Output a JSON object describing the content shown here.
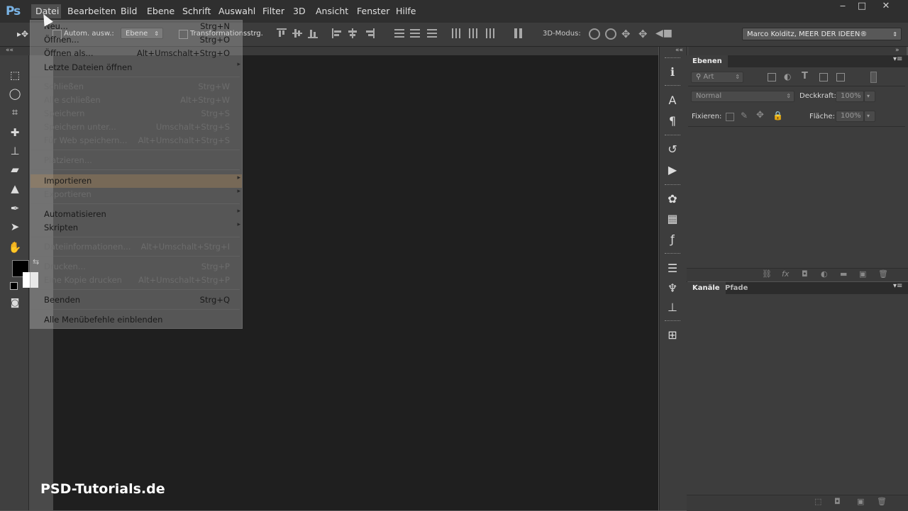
{
  "app": {
    "logo": "Ps"
  },
  "menubar": {
    "items": [
      "Datei",
      "Bearbeiten",
      "Bild",
      "Ebene",
      "Schrift",
      "Auswahl",
      "Filter",
      "3D",
      "Ansicht",
      "Fenster",
      "Hilfe"
    ],
    "window_buttons": {
      "minimize": "‒",
      "maximize": "□",
      "close": "✕"
    }
  },
  "options_bar": {
    "auto_select_label": "Autom. ausw.:",
    "auto_select_value": "Ebene",
    "transform_label": "Transformationsstrg.",
    "mode_3d_label": "3D-Modus:",
    "workspace": "Marco Kolditz, MEER DER IDEEN®"
  },
  "file_menu": {
    "items": [
      {
        "label": "Neu...",
        "shortcut": "Strg+N",
        "disabled": false
      },
      {
        "label": "Öffnen...",
        "shortcut": "Strg+O",
        "disabled": false
      },
      {
        "label": "Öffnen als...",
        "shortcut": "Alt+Umschalt+Strg+O",
        "disabled": false
      },
      {
        "label": "Letzte Dateien öffnen",
        "shortcut": "",
        "submenu": "▸",
        "disabled": false
      },
      {
        "label": "Schließen",
        "shortcut": "Strg+W",
        "disabled": true
      },
      {
        "label": "Alle schließen",
        "shortcut": "Alt+Strg+W",
        "disabled": true
      },
      {
        "label": "Speichern",
        "shortcut": "Strg+S",
        "disabled": true
      },
      {
        "label": "Speichern unter...",
        "shortcut": "Umschalt+Strg+S",
        "disabled": true
      },
      {
        "label": "Für Web speichern...",
        "shortcut": "Alt+Umschalt+Strg+S",
        "disabled": true
      },
      {
        "label": "Platzieren...",
        "shortcut": "",
        "disabled": true
      },
      {
        "label": "Importieren",
        "shortcut": "",
        "submenu": "▸",
        "disabled": false
      },
      {
        "label": "Exportieren",
        "shortcut": "",
        "submenu": "▸",
        "disabled": true
      },
      {
        "label": "Automatisieren",
        "shortcut": "",
        "submenu": "▸",
        "disabled": false
      },
      {
        "label": "Skripten",
        "shortcut": "",
        "submenu": "▸",
        "disabled": false
      },
      {
        "label": "Dateiinformationen...",
        "shortcut": "Alt+Umschalt+Strg+I",
        "disabled": true
      },
      {
        "label": "Drucken...",
        "shortcut": "Strg+P",
        "disabled": true
      },
      {
        "label": "Eine Kopie drucken",
        "shortcut": "Alt+Umschalt+Strg+P",
        "disabled": true
      },
      {
        "label": "Beenden",
        "shortcut": "Strg+Q",
        "disabled": false
      },
      {
        "label": "Alle Menübefehle einblenden",
        "shortcut": "",
        "disabled": false
      }
    ]
  },
  "layers_panel": {
    "tab": "Ebenen",
    "filter_value": "Art",
    "blend_mode": "Normal",
    "opacity_label": "Deckkraft:",
    "opacity_value": "100%",
    "lock_label": "Fixieren:",
    "fill_label": "Fläche:",
    "fill_value": "100%"
  },
  "channels_panel": {
    "tabs": [
      "Kanäle",
      "Pfade"
    ]
  },
  "watermark": "PSD-Tutorials.de",
  "colors": {
    "menubar": "#2f2f2f",
    "canvas": "#1f1f1f",
    "panel": "#3d3d3d",
    "logo": "#7ab4e6"
  }
}
